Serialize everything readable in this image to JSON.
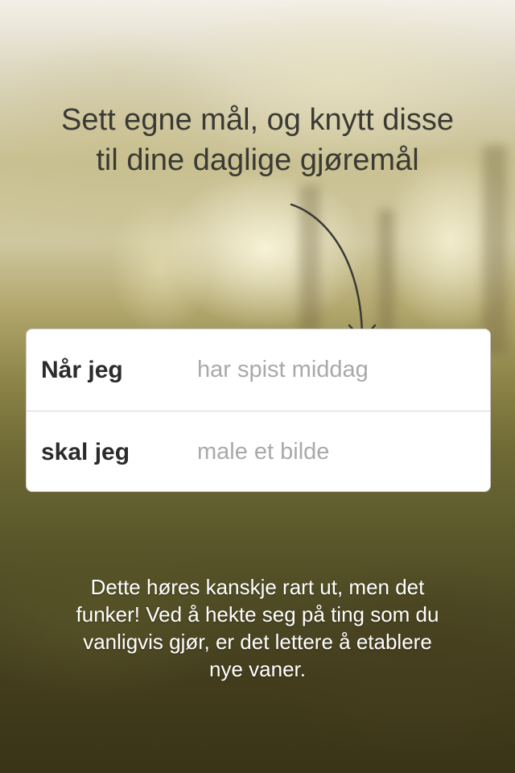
{
  "headline": {
    "line1": "Sett egne mål, og knytt disse",
    "line2": "til dine daglige gjøremål"
  },
  "form": {
    "rows": [
      {
        "label": "Når jeg",
        "placeholder": "har spist middag",
        "value": ""
      },
      {
        "label": "skal jeg",
        "placeholder": "male et bilde",
        "value": ""
      }
    ]
  },
  "body_text": {
    "line1": "Dette høres kanskje rart ut, men det",
    "line2": "funker! Ved å hekte seg på ting som du",
    "line3": "vanligvis gjør, er det lettere å etablere",
    "line4": "nye vaner."
  },
  "colors": {
    "headline": "#3a3a34",
    "label": "#2b2b2b",
    "placeholder": "#a9a9a9",
    "body_text": "#ffffff"
  }
}
